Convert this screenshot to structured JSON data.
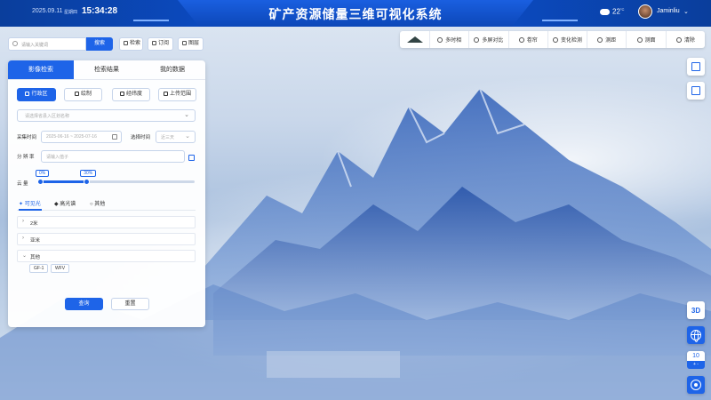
{
  "header": {
    "title": "矿产资源储量三维可视化系统",
    "date": "2025.09.11",
    "weekday": "星期四",
    "time": "15:34:28",
    "temperature": "22",
    "temperature_unit": "°C",
    "username": "Jaminliu",
    "weather_icon": "cloud-icon"
  },
  "search": {
    "placeholder": "请输入关键词",
    "button": "搜索",
    "tools": [
      "检索",
      "订阅",
      "图层"
    ]
  },
  "toolbar": {
    "items": [
      "多时相",
      "多屏对比",
      "卷帘",
      "变化检测",
      "测距",
      "测面",
      "清除"
    ]
  },
  "panel": {
    "tabs": [
      "影像检索",
      "检索结果",
      "我的数据"
    ],
    "modes": [
      "行政区",
      "绘制",
      "经纬度",
      "上传范围"
    ],
    "region_placeholder": "请选择省县入区划名称",
    "acq_time_label": "采集时间",
    "acq_time_value": "2025-06-16 ~ 2025-07-16",
    "select_time_label": "选择时间",
    "select_time_value": "近三天",
    "resolution_label": "分 辨 率",
    "resolution_placeholder": "请输入值子",
    "cloud_label": "云 量",
    "cloud_min": "0%",
    "cloud_max": "30%",
    "cloud_range": [
      0,
      30
    ],
    "categories": [
      "可见光",
      "高光谱",
      "其他"
    ],
    "groups": [
      "2米",
      "亚米",
      "其他"
    ],
    "chips": [
      "GF-1",
      "WFV"
    ],
    "query_button": "查询",
    "reset_button": "重置"
  },
  "side": {
    "label_3d": "3D",
    "zoom_level": "10",
    "zoom_ctrl": "+ -"
  },
  "colors": {
    "header_bg": "#0b4ac0",
    "accent": "#1e64e8"
  }
}
